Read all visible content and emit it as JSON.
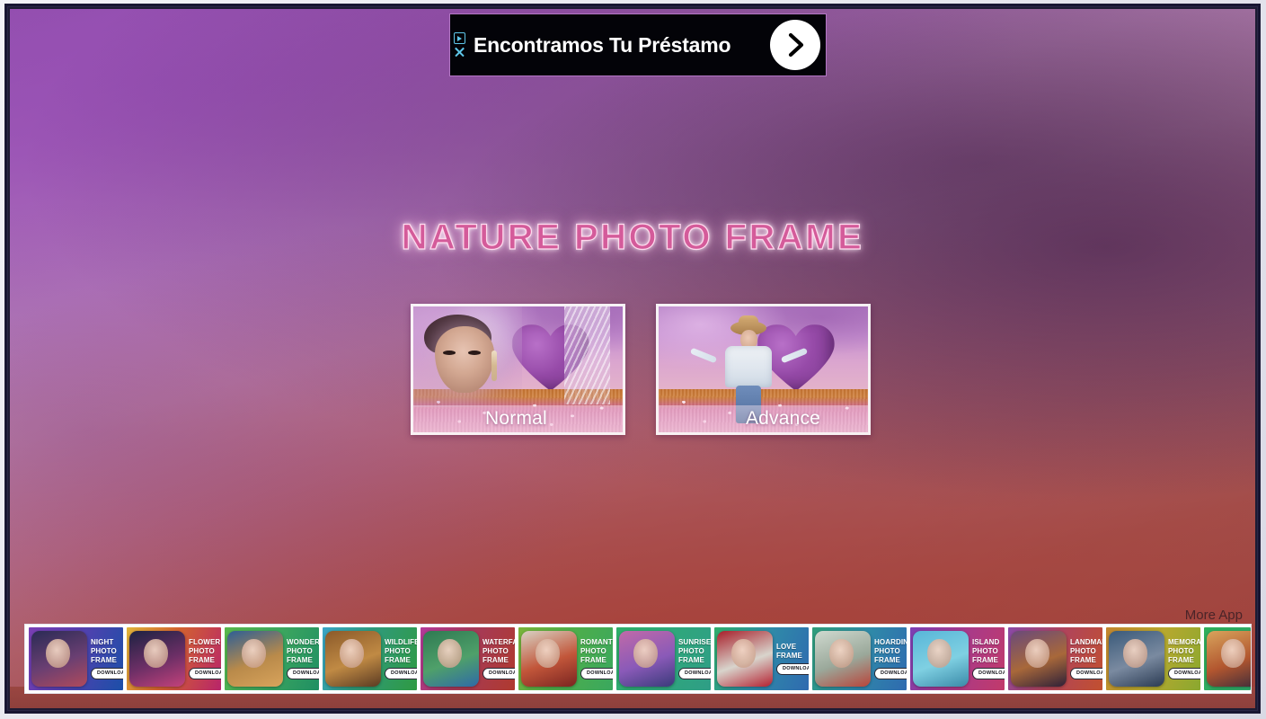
{
  "app": {
    "title": "NATURE PHOTO FRAME",
    "more_app_label": "More App"
  },
  "ad_banner": {
    "headline": "Encontramos Tu Préstamo",
    "adchoices_icon": "adchoices-play-icon",
    "close_icon": "close-icon",
    "cta_icon": "chevron-right-circle-icon"
  },
  "modes": [
    {
      "id": "normal",
      "label": "Normal"
    },
    {
      "id": "advance",
      "label": "Advance"
    }
  ],
  "ad_strip": {
    "download_label": "DOWNLOAD",
    "tiles": [
      {
        "lines": [
          "NIGHT",
          "PHOTO",
          "FRAME"
        ],
        "bg": "linear-gradient(110deg,#7b3fb5 0%,#5a3fb0 40%,#1b4fa8 100%)",
        "thumb": "linear-gradient(160deg,#2a2b55,#6a3f72 55%,#b04a5c)"
      },
      {
        "lines": [
          "FLOWER",
          "PHOTO",
          "FRAME"
        ],
        "bg": "linear-gradient(110deg,#e0b43a 0%,#d3632f 45%,#b8246a 100%)",
        "thumb": "linear-gradient(160deg,#1d2242,#6d2f66 55%,#c3427b)"
      },
      {
        "lines": [
          "WONDER",
          "PHOTO",
          "FRAME"
        ],
        "bg": "linear-gradient(110deg,#59b84b 0%,#3fa85e 45%,#1f8f63 100%)",
        "thumb": "linear-gradient(160deg,#2e5f95,#b98a4a 55%,#d9a45c)"
      },
      {
        "lines": [
          "WILDLIFE",
          "PHOTO",
          "FRAME"
        ],
        "bg": "linear-gradient(110deg,#3aa6c8 0%,#2f9a7a 45%,#2f9a42 100%)",
        "thumb": "linear-gradient(160deg,#8b5a2a,#c08a44 55%,#5a3a22)"
      },
      {
        "lines": [
          "WATERFALL",
          "PHOTO",
          "FRAME"
        ],
        "bg": "linear-gradient(110deg,#b43a9b 0%,#a53a5a 45%,#b03a2e 100%)",
        "thumb": "linear-gradient(160deg,#2f7a52,#4fa06a 55%,#2e6aa8)"
      },
      {
        "lines": [
          "ROMANTIC",
          "PHOTO",
          "FRAME"
        ],
        "bg": "linear-gradient(110deg,#7ab43a 0%,#4fae4a 45%,#3aa85e 100%)",
        "thumb": "linear-gradient(160deg,#d8d2c4,#c2563a 55%,#7a2420)"
      },
      {
        "lines": [
          "SUNRISE",
          "PHOTO",
          "FRAME"
        ],
        "bg": "linear-gradient(110deg,#2fae6a 0%,#2fa87a 45%,#2f9e86 100%)",
        "thumb": "linear-gradient(160deg,#c06aa8,#8a5ab8 55%,#3a3a7a)"
      },
      {
        "lines": [
          "LOVE",
          "FRAME"
        ],
        "bg": "linear-gradient(110deg,#2fae6a 0%,#2f8aa8 50%,#2f6ab0 100%)",
        "thumb": "linear-gradient(160deg,#a81f2a,#d8d4cc 55%,#b42030)"
      },
      {
        "lines": [
          "HOARDING",
          "PHOTO",
          "FRAME"
        ],
        "bg": "linear-gradient(110deg,#2f9e7a 0%,#2f8aa8 50%,#2f6ab0 100%)",
        "thumb": "linear-gradient(160deg,#cfd9cf,#9aa89a 55%,#b8443a)"
      },
      {
        "lines": [
          "ISLAND",
          "PHOTO",
          "FRAME"
        ],
        "bg": "linear-gradient(110deg,#7b3fb5 0%,#a83a8a 50%,#c23a6a 100%)",
        "thumb": "linear-gradient(160deg,#58b6d8,#7fd0e2 55%,#3a8aa8)"
      },
      {
        "lines": [
          "LANDMARK",
          "PHOTO",
          "FRAME"
        ],
        "bg": "linear-gradient(110deg,#8a4aa8 0%,#b0445a 50%,#c2502f 100%)",
        "thumb": "linear-gradient(160deg,#6a4a7a,#a8683a 55%,#2e2038)"
      },
      {
        "lines": [
          "MEMORABLE",
          "PHOTO",
          "FRAME"
        ],
        "bg": "linear-gradient(110deg,#c2852f 0%,#b8a82f 50%,#8aa82f 100%)",
        "thumb": "linear-gradient(160deg,#3a5a7a,#7a8aa0 55%,#2a3a52)"
      },
      {
        "lines": [],
        "bg": "linear-gradient(110deg,#2fae5a 0%,#2fa86a 100%)",
        "thumb": "linear-gradient(160deg,#d8a45c,#b2562f 55%,#3a2a3a)"
      }
    ]
  }
}
